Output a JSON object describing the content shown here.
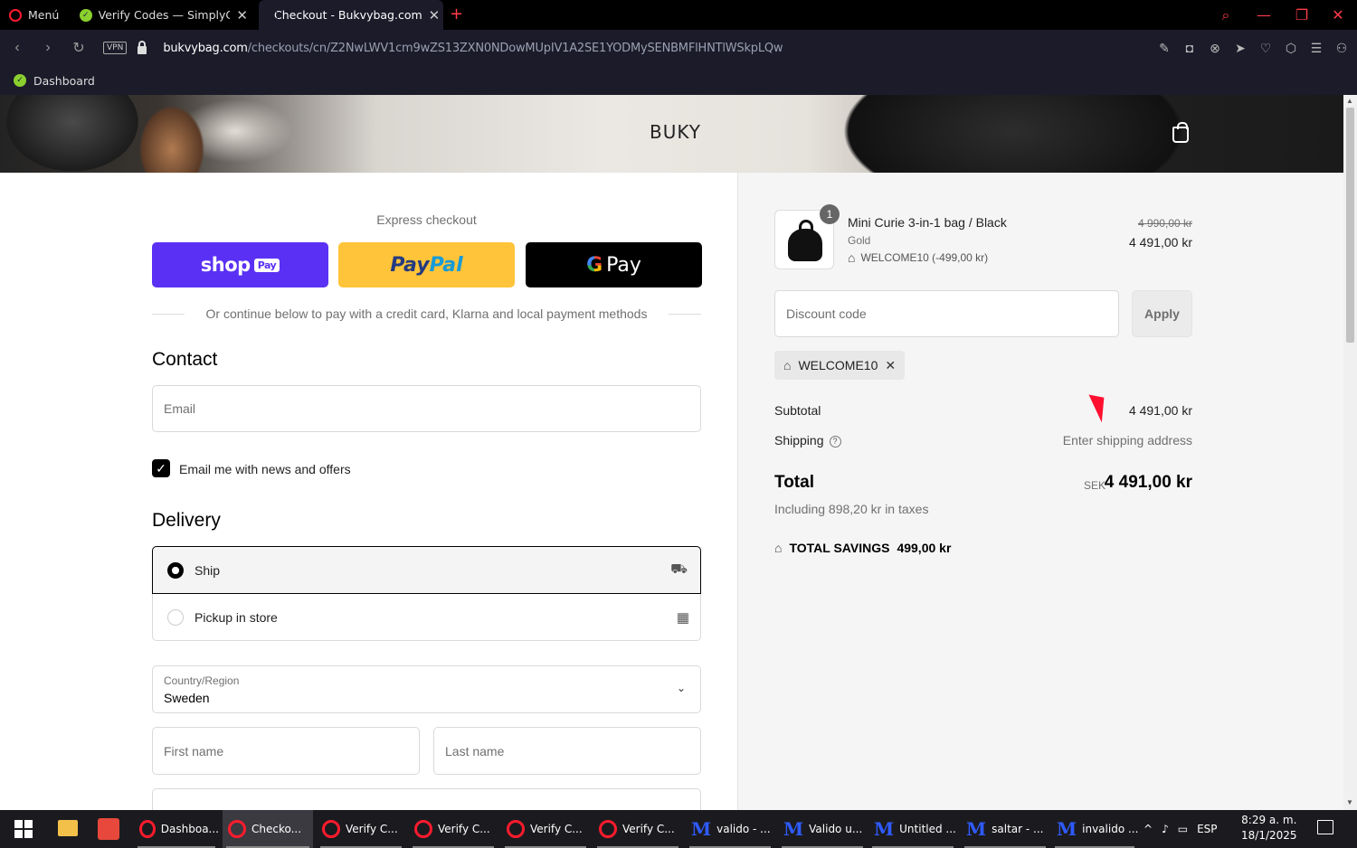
{
  "browser": {
    "menu_label": "Menú",
    "tabs": [
      {
        "title": "Verify Codes — SimplyCodes"
      },
      {
        "title": "Checkout - Bukvybag.com"
      }
    ],
    "url_host": "bukvybag.com",
    "url_path": "/checkouts/cn/Z2NwLWV1cm9wZS13ZXN0NDowMUpIV1A2SE1YODMySENBMFlHNTlWSkpLQw",
    "vpn_label": "VPN",
    "bookmark": "Dashboard"
  },
  "store": {
    "brand": "BUKY"
  },
  "checkout": {
    "express_title": "Express checkout",
    "shop_pay": {
      "word": "shop",
      "badge": "Pay"
    },
    "paypal": {
      "p1": "Pay",
      "p2": "Pal"
    },
    "gpay": {
      "g": "G",
      "pay": "Pay"
    },
    "divider_text": "Or continue below to pay with a credit card, Klarna and local payment methods",
    "contact_heading": "Contact",
    "email_placeholder": "Email",
    "newsletter_label": "Email me with news and offers",
    "newsletter_checked": true,
    "delivery_heading": "Delivery",
    "delivery_options": [
      {
        "label": "Ship",
        "selected": true,
        "icon": "truck-icon"
      },
      {
        "label": "Pickup in store",
        "selected": false,
        "icon": "store-icon"
      }
    ],
    "country_label": "Country/Region",
    "country_value": "Sweden",
    "first_name_placeholder": "First name",
    "last_name_placeholder": "Last name"
  },
  "summary": {
    "item": {
      "quantity": "1",
      "name": "Mini Curie 3-in-1 bag / Black",
      "variant": "Gold",
      "discount": "WELCOME10 (-499,00 kr)",
      "price_original": "4 990,00 kr",
      "price_final": "4 491,00 kr"
    },
    "discount_placeholder": "Discount code",
    "apply_label": "Apply",
    "applied_code": "WELCOME10",
    "subtotal_label": "Subtotal",
    "subtotal_value": "4 491,00 kr",
    "shipping_label": "Shipping",
    "shipping_value": "Enter shipping address",
    "total_label": "Total",
    "total_currency": "SEK",
    "total_value": "4 491,00 kr",
    "taxes_text": "Including 898,20 kr in taxes",
    "savings_label": "TOTAL SAVINGS",
    "savings_value": "499,00 kr"
  },
  "taskbar": {
    "items": [
      "Dashboa...",
      "Checko...",
      "Verify C...",
      "Verify C...",
      "Verify C...",
      "Verify C...",
      "valido - ...",
      "Valido u...",
      "Untitled ...",
      "saltar - ...",
      "invalido ..."
    ],
    "language": "ESP",
    "time": "8:29 a. m.",
    "date": "18/1/2025"
  }
}
